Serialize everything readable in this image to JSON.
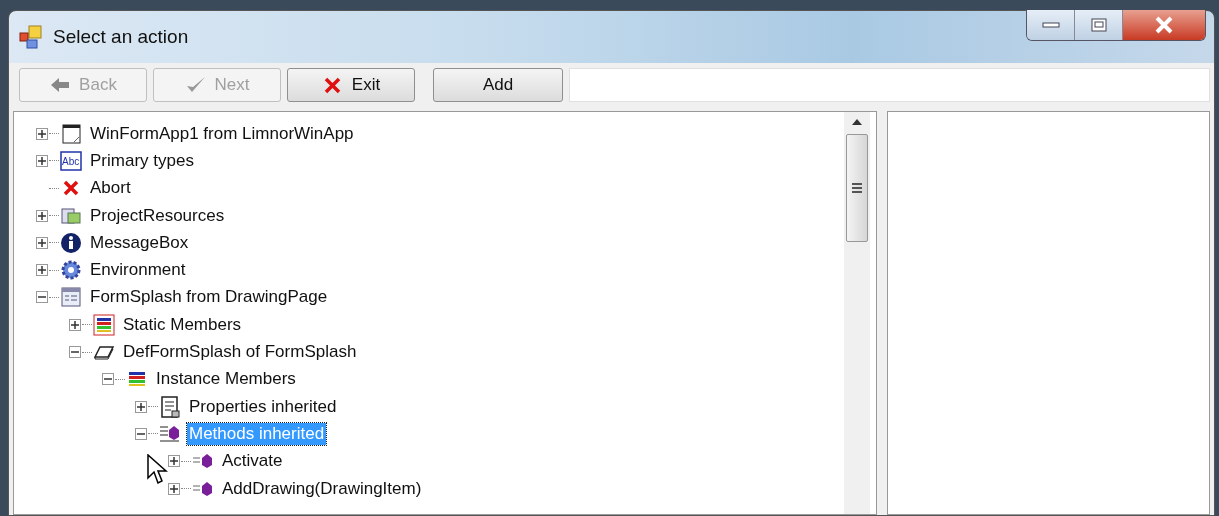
{
  "window": {
    "title": "Select an action"
  },
  "toolbar": {
    "buttons": [
      {
        "kind": "back",
        "label": "Back",
        "disabled": true
      },
      {
        "kind": "next",
        "label": "Next",
        "disabled": true
      },
      {
        "kind": "exit",
        "label": "Exit",
        "disabled": false
      },
      {
        "kind": "add",
        "label": "Add",
        "disabled": false
      }
    ]
  },
  "tree": {
    "items": [
      {
        "kind": "window",
        "label": "WinFormApp1 from LimnorWinApp",
        "expanded": false,
        "selected": false
      },
      {
        "kind": "abc",
        "icon_text": "Abc",
        "label": "Primary types",
        "expanded": false,
        "selected": false
      },
      {
        "kind": "cross",
        "label": "Abort",
        "selected": false
      },
      {
        "kind": "resources",
        "label": "ProjectResources",
        "expanded": false,
        "selected": false
      },
      {
        "kind": "info",
        "label": "MessageBox",
        "expanded": false,
        "selected": false
      },
      {
        "kind": "gear",
        "label": "Environment",
        "expanded": false,
        "selected": false
      },
      {
        "kind": "form",
        "label": "FormSplash from DrawingPage",
        "expanded": true,
        "selected": false,
        "children": [
          {
            "kind": "static",
            "label": "Static Members",
            "expanded": false,
            "selected": false
          },
          {
            "kind": "shape",
            "label": "DefFormSplash of FormSplash",
            "expanded": true,
            "selected": false,
            "children": [
              {
                "kind": "members",
                "label": "Instance Members",
                "expanded": true,
                "selected": false,
                "children": [
                  {
                    "kind": "properties",
                    "label": "Properties inherited",
                    "expanded": false,
                    "selected": false
                  },
                  {
                    "kind": "methods",
                    "label": "Methods inherited",
                    "expanded": true,
                    "selected": true,
                    "children": [
                      {
                        "kind": "method",
                        "label": "Activate",
                        "expanded": false,
                        "selected": false
                      },
                      {
                        "kind": "method",
                        "label": "AddDrawing(DrawingItem)",
                        "expanded": false,
                        "selected": false
                      }
                    ]
                  }
                ]
              }
            ]
          }
        ]
      }
    ]
  }
}
